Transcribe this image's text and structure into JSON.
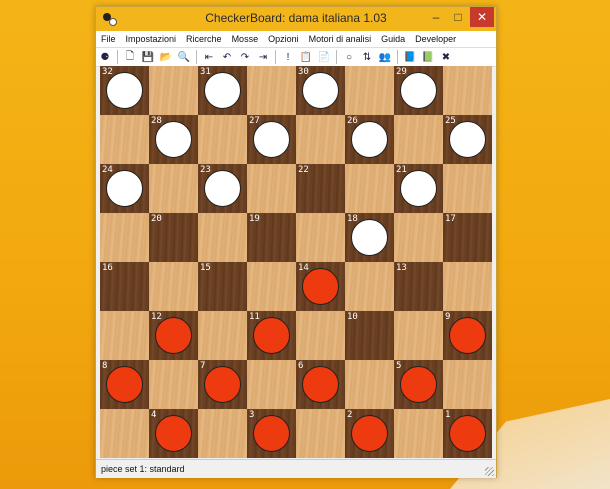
{
  "window": {
    "title": "CheckerBoard: dama italiana 1.03",
    "minimize": "–",
    "maximize": "□",
    "close": "✕"
  },
  "menu": [
    "File",
    "Impostazioni",
    "Ricerche",
    "Mosse",
    "Opzioni",
    "Motori di analisi",
    "Guida",
    "Developer"
  ],
  "toolbar": [
    {
      "name": "engine-icon",
      "glyph": "⚈"
    },
    {
      "sep": true
    },
    {
      "name": "new-file-icon",
      "glyph": "🗋"
    },
    {
      "name": "save-icon",
      "glyph": "💾"
    },
    {
      "name": "open-folder-icon",
      "glyph": "📂"
    },
    {
      "name": "search-icon",
      "glyph": "🔍"
    },
    {
      "sep": true
    },
    {
      "name": "go-start-icon",
      "glyph": "⇤"
    },
    {
      "name": "undo-icon",
      "glyph": "↶"
    },
    {
      "name": "redo-icon",
      "glyph": "↷"
    },
    {
      "name": "go-end-icon",
      "glyph": "⇥"
    },
    {
      "sep": true
    },
    {
      "name": "exclamation-icon",
      "glyph": "!"
    },
    {
      "name": "copy-icon",
      "glyph": "📋"
    },
    {
      "name": "paste-icon",
      "glyph": "📄"
    },
    {
      "sep": true
    },
    {
      "name": "circle-icon",
      "glyph": "○"
    },
    {
      "name": "swap-icon",
      "glyph": "⇅"
    },
    {
      "name": "users-icon",
      "glyph": "👥"
    },
    {
      "sep": true
    },
    {
      "name": "book-icon",
      "glyph": "📘"
    },
    {
      "name": "book-add-icon",
      "glyph": "📗"
    },
    {
      "name": "delete-icon",
      "glyph": "✖"
    }
  ],
  "board": {
    "rows": [
      [
        {
          "c": "d",
          "n": "32",
          "p": "w"
        },
        {
          "c": "l"
        },
        {
          "c": "d",
          "n": "31",
          "p": "w"
        },
        {
          "c": "l"
        },
        {
          "c": "d",
          "n": "30",
          "p": "w"
        },
        {
          "c": "l"
        },
        {
          "c": "d",
          "n": "29",
          "p": "w"
        },
        {
          "c": "l"
        }
      ],
      [
        {
          "c": "l"
        },
        {
          "c": "d",
          "n": "28",
          "p": "w"
        },
        {
          "c": "l"
        },
        {
          "c": "d",
          "n": "27",
          "p": "w"
        },
        {
          "c": "l"
        },
        {
          "c": "d",
          "n": "26",
          "p": "w"
        },
        {
          "c": "l"
        },
        {
          "c": "d",
          "n": "25",
          "p": "w"
        }
      ],
      [
        {
          "c": "d",
          "n": "24",
          "p": "w"
        },
        {
          "c": "l"
        },
        {
          "c": "d",
          "n": "23",
          "p": "w"
        },
        {
          "c": "l"
        },
        {
          "c": "d",
          "n": "22"
        },
        {
          "c": "l"
        },
        {
          "c": "d",
          "n": "21",
          "p": "w"
        },
        {
          "c": "l"
        }
      ],
      [
        {
          "c": "l"
        },
        {
          "c": "d",
          "n": "20"
        },
        {
          "c": "l"
        },
        {
          "c": "d",
          "n": "19"
        },
        {
          "c": "l"
        },
        {
          "c": "d",
          "n": "18",
          "p": "w"
        },
        {
          "c": "l"
        },
        {
          "c": "d",
          "n": "17"
        }
      ],
      [
        {
          "c": "d",
          "n": "16"
        },
        {
          "c": "l"
        },
        {
          "c": "d",
          "n": "15"
        },
        {
          "c": "l"
        },
        {
          "c": "d",
          "n": "14",
          "p": "r"
        },
        {
          "c": "l"
        },
        {
          "c": "d",
          "n": "13"
        },
        {
          "c": "l"
        }
      ],
      [
        {
          "c": "l"
        },
        {
          "c": "d",
          "n": "12",
          "p": "r"
        },
        {
          "c": "l"
        },
        {
          "c": "d",
          "n": "11",
          "p": "r"
        },
        {
          "c": "l"
        },
        {
          "c": "d",
          "n": "10"
        },
        {
          "c": "l"
        },
        {
          "c": "d",
          "n": "9",
          "p": "r"
        }
      ],
      [
        {
          "c": "d",
          "n": "8",
          "p": "r"
        },
        {
          "c": "l"
        },
        {
          "c": "d",
          "n": "7",
          "p": "r"
        },
        {
          "c": "l"
        },
        {
          "c": "d",
          "n": "6",
          "p": "r"
        },
        {
          "c": "l"
        },
        {
          "c": "d",
          "n": "5",
          "p": "r"
        },
        {
          "c": "l"
        }
      ],
      [
        {
          "c": "l"
        },
        {
          "c": "d",
          "n": "4",
          "p": "r"
        },
        {
          "c": "l"
        },
        {
          "c": "d",
          "n": "3",
          "p": "r"
        },
        {
          "c": "l"
        },
        {
          "c": "d",
          "n": "2",
          "p": "r"
        },
        {
          "c": "l"
        },
        {
          "c": "d",
          "n": "1",
          "p": "r"
        }
      ]
    ]
  },
  "status": {
    "text": "piece set 1: standard"
  },
  "colors": {
    "white_piece": "#ffffff",
    "red_piece": "#ee3a0f",
    "titlebar": "#f2b61c",
    "close": "#c7392a"
  }
}
